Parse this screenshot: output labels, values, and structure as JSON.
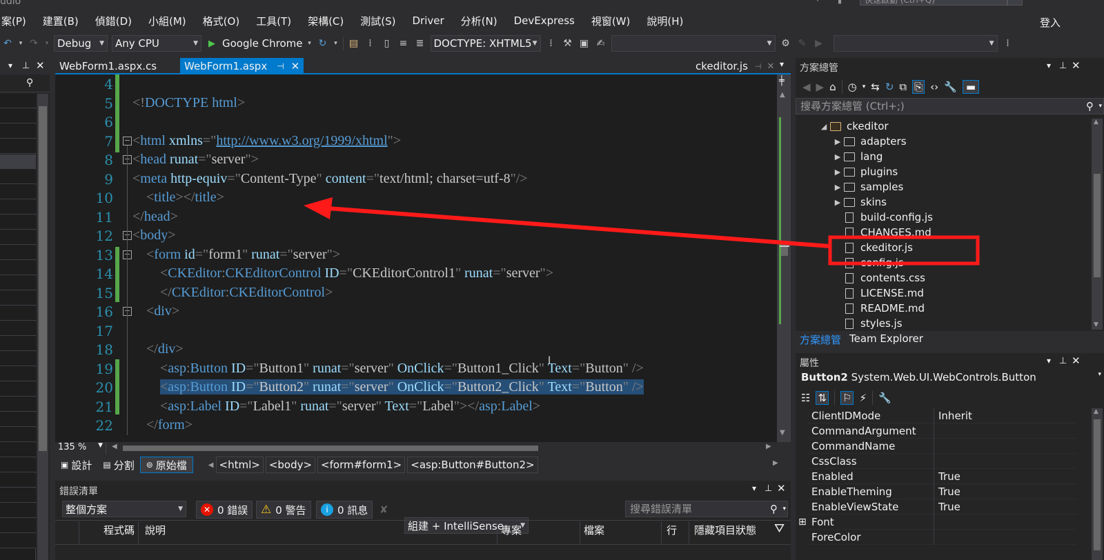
{
  "titlebar": {
    "partial_title": "udio",
    "search_placeholder": "快速啟動 (Ctrl+Q)"
  },
  "menu": [
    "案(P)",
    "建置(B)",
    "偵錯(D)",
    "小組(M)",
    "格式(O)",
    "工具(T)",
    "架構(C)",
    "測試(S)",
    "Driver",
    "分析(N)",
    "DevExpress",
    "視窗(W)",
    "說明(H)"
  ],
  "login": "登入",
  "toolbar": {
    "config": "Debug",
    "platform": "Any CPU",
    "browser": "Google Chrome",
    "doctype": "DOCTYPE: XHTML5"
  },
  "tabs": {
    "tab1": "WebForm1.aspx.cs",
    "tab2": "WebForm1.aspx",
    "right_tab": "ckeditor.js"
  },
  "editor": {
    "line_numbers": [
      "4",
      "5",
      "6",
      "7",
      "8",
      "9",
      "10",
      "11",
      "12",
      "13",
      "14",
      "15",
      "16",
      "17",
      "18",
      "19",
      "20",
      "21",
      "22"
    ],
    "zoom": "135 %"
  },
  "view": {
    "design": "設計",
    "split": "分割",
    "source": "原始檔",
    "crumbs": [
      "<html>",
      "<body>",
      "<form#form1>",
      "<asp:Button#Button2>"
    ]
  },
  "errorlist": {
    "title": "錯誤清單",
    "scope": "整個方案",
    "errors": "0 錯誤",
    "warnings": "0 警告",
    "messages": "0 訊息",
    "build": "組建 + IntelliSense",
    "search_placeholder": "搜尋錯誤清單",
    "columns": [
      "程式碼",
      "說明",
      "專案",
      "檔案",
      "行",
      "隱藏項目狀態"
    ]
  },
  "solution": {
    "title": "方案總管",
    "search_placeholder": "搜尋方案總管 (Ctrl+;)",
    "root": "ckeditor",
    "folders": [
      "adapters",
      "lang",
      "plugins",
      "samples",
      "skins"
    ],
    "files": [
      "build-config.js",
      "CHANGES.md",
      "ckeditor.js",
      "config.js",
      "contents.css",
      "LICENSE.md",
      "README.md",
      "styles.js"
    ],
    "tab_active": "方案總管",
    "tab_other": "Team Explorer"
  },
  "properties": {
    "title": "屬性",
    "object_name": "Button2",
    "object_type": "System.Web.UI.WebControls.Button",
    "rows": [
      {
        "name": "ClientIDMode",
        "value": "Inherit"
      },
      {
        "name": "CommandArgument",
        "value": ""
      },
      {
        "name": "CommandName",
        "value": ""
      },
      {
        "name": "CssClass",
        "value": ""
      },
      {
        "name": "Enabled",
        "value": "True"
      },
      {
        "name": "EnableTheming",
        "value": "True"
      },
      {
        "name": "EnableViewState",
        "value": "True"
      },
      {
        "name": "Font",
        "value": ""
      },
      {
        "name": "ForeColor",
        "value": ""
      }
    ]
  },
  "colors": {
    "annotation": "#ff1a1a",
    "selection": "#264f78",
    "tag": "#569cd6",
    "attr": "#9cdcfe",
    "active_tab": "#007acc"
  }
}
